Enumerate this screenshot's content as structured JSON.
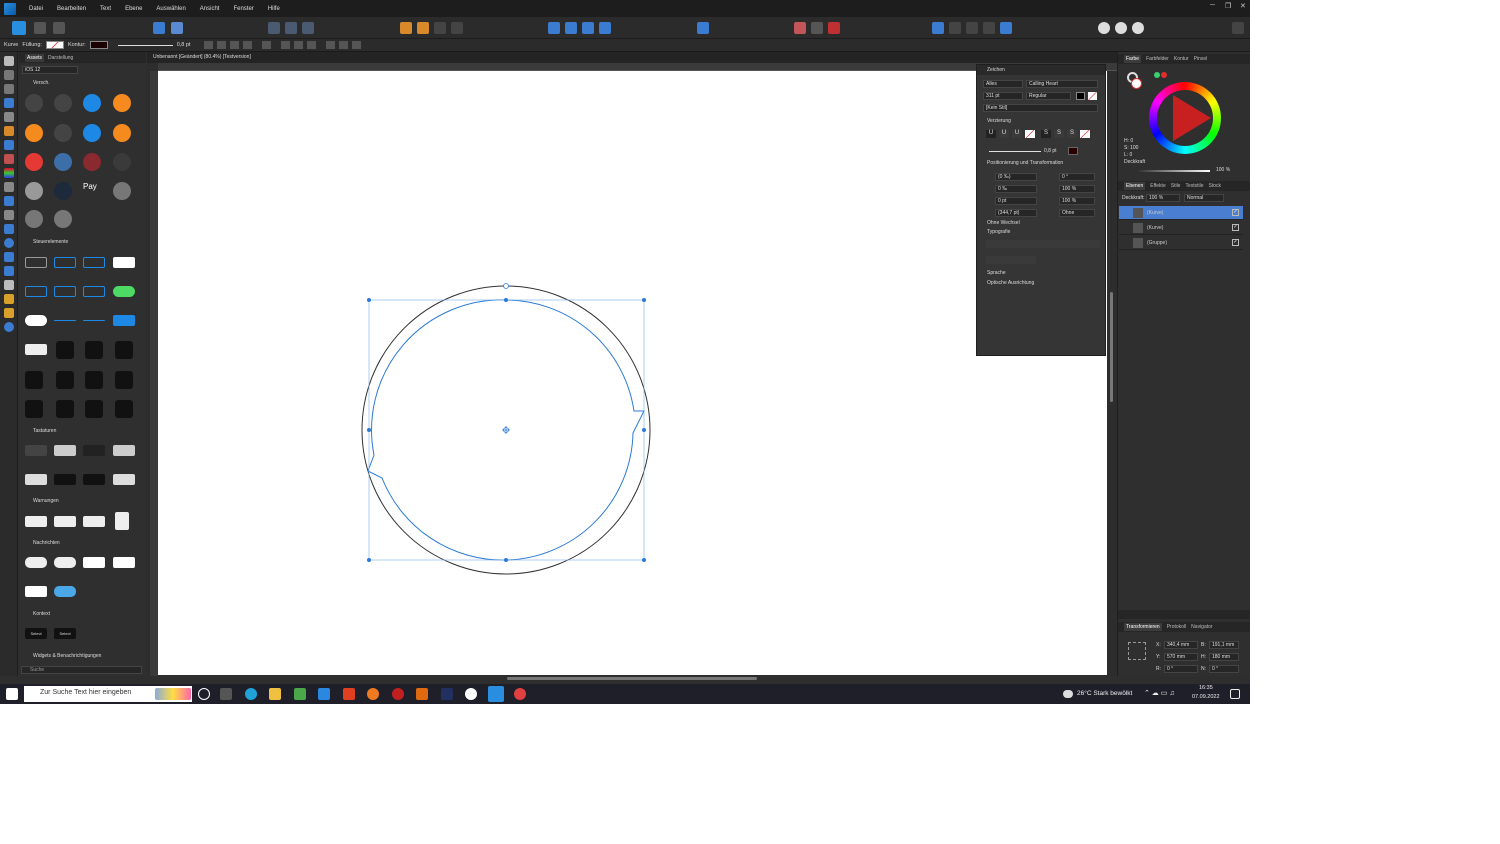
{
  "menu": [
    "Datei",
    "Bearbeiten",
    "Text",
    "Ebene",
    "Auswählen",
    "Ansicht",
    "Fenster",
    "Hilfe"
  ],
  "context": {
    "tool": "Kurve",
    "fill_label": "Füllung:",
    "stroke_label": "Kontur:",
    "stroke_width": "0,8 pt"
  },
  "assets": {
    "tabs": [
      "Assets",
      "Darstellung"
    ],
    "category": "iOS 12",
    "sections": [
      "Versch.",
      "Steuerelemente",
      "Tastaturen",
      "Warnungen",
      "Nachrichten",
      "Kontext",
      "Widgets & Benachrichtigungen"
    ],
    "search_placeholder": "Suche",
    "context_items": [
      "Select",
      "Select"
    ]
  },
  "document": {
    "tab": "Unbenannt [Geändert] (80.4%) [Testversion]"
  },
  "character": {
    "title": "Zeichen",
    "scope": "Alles",
    "font": "Calling Heart",
    "size": "311 pt",
    "style": "Regular",
    "paragraph_style": "[Kein Stil]",
    "decoration_hdr": "Verzierung",
    "deco_width": "0,8 pt",
    "pos_hdr": "Positionierung und Transformation",
    "kern": "(0 ‰)",
    "tracking": "0 ‰",
    "baseline": "0 pt",
    "leading": "(344,7 pt)",
    "shear": "0 °",
    "vscale": "100 %",
    "hscale": "100 %",
    "leading_mode": "Ohne",
    "case": "Ohne Wechsel",
    "typo_hdr": "Typografie",
    "language": "Sprache",
    "optical": "Optische Ausrichtung"
  },
  "color": {
    "tabs": [
      "Farbe",
      "Farbfelder",
      "Kontur",
      "Pinsel"
    ],
    "h": "H: 0",
    "s": "S: 100",
    "l": "L: 0",
    "opacity_label": "Deckkraft",
    "opacity": "100 %",
    "accent": "#e52d2d"
  },
  "layers": {
    "tabs": [
      "Ebenen",
      "Effekte",
      "Stile",
      "Textstile",
      "Stock"
    ],
    "opacity_label": "Deckkraft:",
    "opacity": "100 %",
    "blend": "Normal",
    "items": [
      "(Kurve)",
      "(Kurve)",
      "(Gruppe)"
    ]
  },
  "transform": {
    "tabs": [
      "Transformieren",
      "Protokoll",
      "Navigator"
    ],
    "x": "340,4 mm",
    "y": "570 mm",
    "w": "191,1 mm",
    "h": "180 mm",
    "r": "0 °",
    "s": "0 °",
    "x_label": "X:",
    "y_label": "Y:",
    "w_label": "B:",
    "h_label": "H:",
    "r_label": "R:",
    "s_label": "N:"
  },
  "taskbar": {
    "search": "Zur Suche Text hier eingeben",
    "weather": "26°C  Stark bewölkt",
    "time": "16:35",
    "date": "07.09.2022"
  }
}
